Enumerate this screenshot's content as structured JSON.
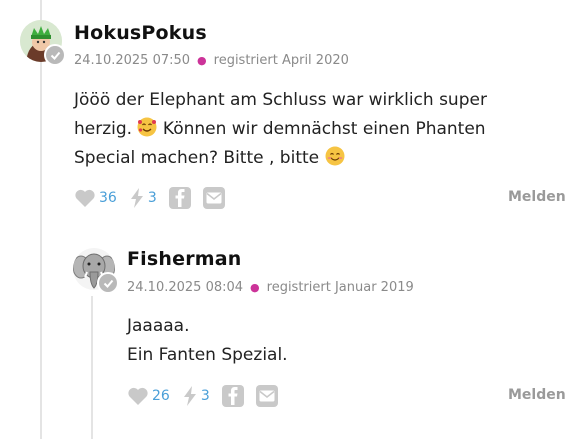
{
  "comments": [
    {
      "username": "HokusPokus",
      "date": "24.10.2025 07:50",
      "registered": "registriert April 2020",
      "text_line1": "Jööö der Elephant am Schluss war wirklich super",
      "text_line2_a": "herzig.",
      "text_line2_b": "Können wir demnächst einen Phanten",
      "text_line3": "Special machen? Bitte , bitte",
      "likes": "36",
      "bolts": "3",
      "report_label": "Melden"
    },
    {
      "username": "Fisherman",
      "date": "24.10.2025 08:04",
      "registered": "registriert Januar 2019",
      "text_line1": "Jaaaaa.",
      "text_line2": "Ein Fanten Spezial.",
      "likes": "26",
      "bolts": "3",
      "report_label": "Melden"
    }
  ],
  "icons": {
    "like": "heart-icon",
    "bolt": "bolt-icon",
    "facebook": "facebook-icon",
    "mail": "mail-icon",
    "verified": "checkmark-icon"
  },
  "colors": {
    "accent_count": "#4a9fd8",
    "meta_dot": "#cc3399",
    "icon_grey": "#c9c9c9"
  }
}
